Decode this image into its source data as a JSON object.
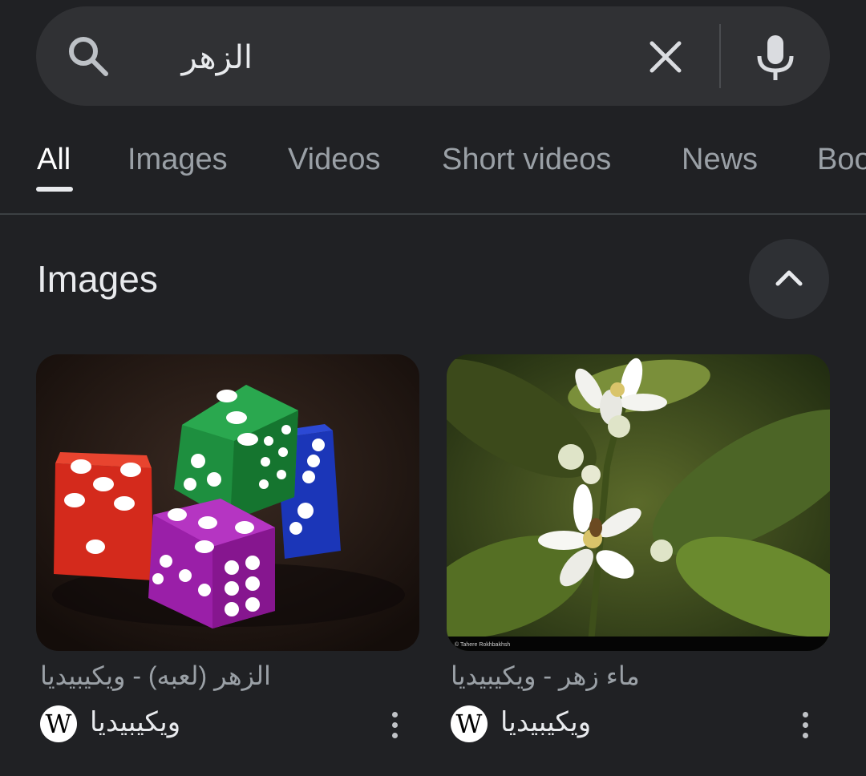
{
  "search": {
    "query": "الزهر",
    "icon": "search-icon",
    "clear_icon": "close-icon",
    "mic_icon": "microphone-icon"
  },
  "tabs": [
    {
      "label": "All",
      "active": true
    },
    {
      "label": "Images",
      "active": false
    },
    {
      "label": "Videos",
      "active": false
    },
    {
      "label": "Short videos",
      "active": false
    },
    {
      "label": "News",
      "active": false
    },
    {
      "label": "Boo",
      "active": false
    }
  ],
  "images_section": {
    "title": "Images",
    "collapse_icon": "chevron-up-icon",
    "results": [
      {
        "title": "الزهر (لعبه) - ويكيبيديا",
        "source": "ويكيبيديا",
        "source_logo": "W",
        "image": "dice-photo"
      },
      {
        "title": "ماء زهر - ويكيبيديا",
        "source": "ويكيبيديا",
        "source_logo": "W",
        "image": "orange-blossom-photo",
        "image_caption": "© Tahere Rokhbakhsh"
      }
    ]
  },
  "colors": {
    "background": "#202124",
    "search_bar": "#303134",
    "active_tab": "#ffffff",
    "inactive_tab": "#9aa0a6"
  }
}
